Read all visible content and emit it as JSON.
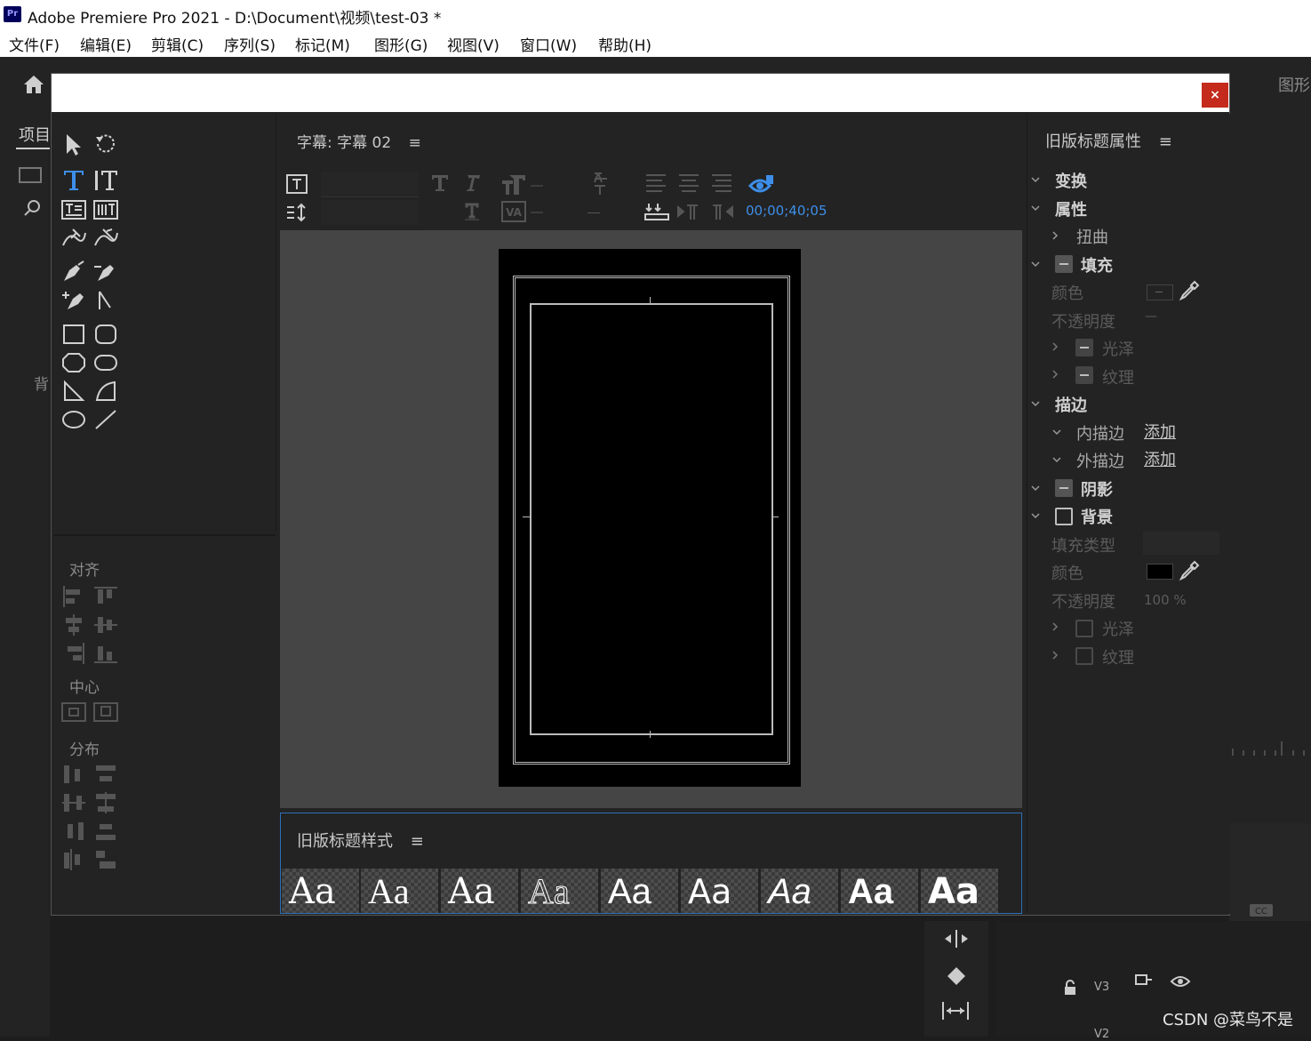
{
  "window": {
    "app_icon": "Pr",
    "title": "Adobe Premiere Pro 2021 - D:\\Document\\视频\\test-03 *"
  },
  "menu": [
    "文件(F)",
    "编辑(E)",
    "剪辑(C)",
    "序列(S)",
    "标记(M)",
    "图形(G)",
    "视图(V)",
    "窗口(W)",
    "帮助(H)"
  ],
  "app": {
    "right_tab": "图形",
    "project_tab": "项目",
    "left_text": "背",
    "watermark": "CSDN @菜鸟不是"
  },
  "dialog": {
    "close_label": "×",
    "title_panel": {
      "title": "字幕: 字幕 02",
      "menu_icon": "≡",
      "timecode": "00;00;40;05"
    },
    "align_panel": {
      "align": "对齐",
      "center": "中心",
      "distribute": "分布"
    },
    "styles_panel": {
      "title": "旧版标题样式",
      "menu_icon": "≡",
      "swatches": [
        "Aa",
        "Aa",
        "Aa",
        "Aa",
        "Aa",
        "Aa",
        "Aa",
        "Aa",
        "Aa"
      ]
    },
    "properties": {
      "title": "旧版标题属性",
      "menu_icon": "≡",
      "transform": "变换",
      "attributes": "属性",
      "distort": "扭曲",
      "fill": "填充",
      "fill_color": "颜色",
      "fill_opacity": "不透明度",
      "fill_opacity_value": "—",
      "fill_sheen": "光泽",
      "fill_texture": "纹理",
      "stroke": "描边",
      "inner_stroke": "内描边",
      "outer_stroke": "外描边",
      "add": "添加",
      "shadow": "阴影",
      "background": "背景",
      "bg_fill_type": "填充类型",
      "bg_color": "颜色",
      "bg_opacity": "不透明度",
      "bg_opacity_value": "100 %",
      "bg_sheen": "光泽",
      "bg_texture": "纹理",
      "bg_color_hex": "#000000"
    }
  },
  "timeline": {
    "tracks": [
      "V3",
      "V2"
    ]
  }
}
